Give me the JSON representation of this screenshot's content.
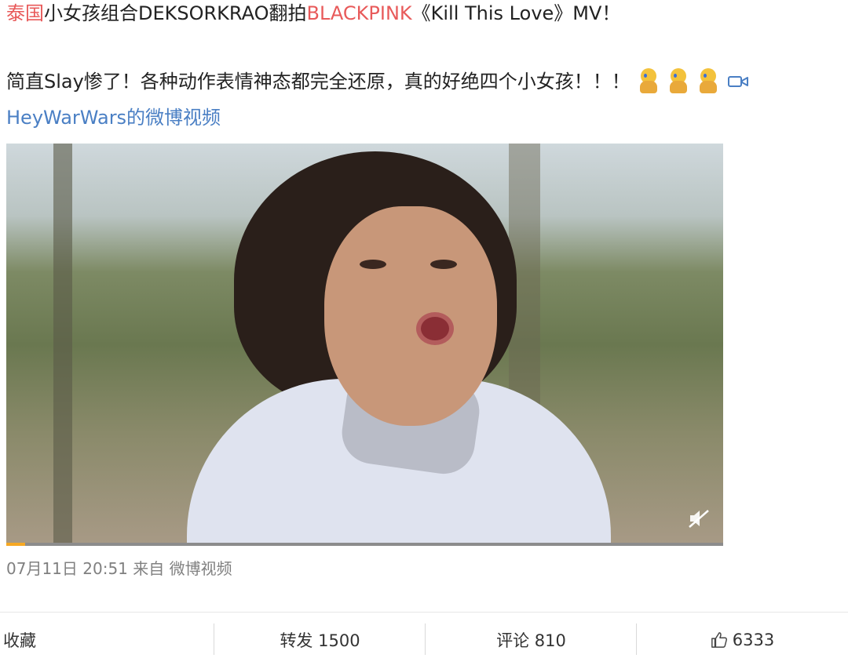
{
  "post": {
    "line1": {
      "tag": "泰国",
      "text_a": "小女孩组合DEKSORKRAO翻拍",
      "tag2": "BLACKPINK",
      "text_b": "《Kill This Love》MV！"
    },
    "line2": "简直Slay惨了！各种动作表情神态都完全还原，真的好绝四个小女孩！！！",
    "emojis": [
      "crying-emoji",
      "crying-emoji",
      "crying-emoji"
    ],
    "video_link_text": "HeyWarWars的微博视频",
    "video": {
      "progress_fraction": 0.026,
      "muted": true
    },
    "meta": "07月11日 20:51  来自 微博视频"
  },
  "actions": {
    "favorite_label": "收藏",
    "repost_label": "转发 1500",
    "comment_label": "评论 810",
    "like_count": "6333"
  },
  "colors": {
    "topic_red": "#e85a5a",
    "link_blue": "#4a7fc4",
    "progress_orange": "#f6a823"
  }
}
